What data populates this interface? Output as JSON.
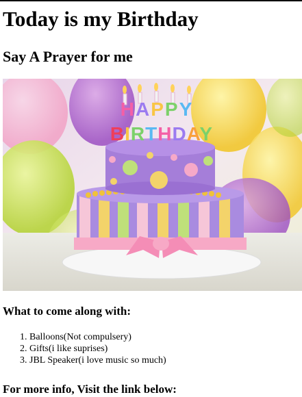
{
  "heading": "Today is my Birthday",
  "subheading": "Say A Prayer for me",
  "image": {
    "description_icon": "birthday-cake-image",
    "cake_text_top": "HAPPY",
    "cake_text_bottom": "BIRTHDAY"
  },
  "bring_heading": "What to come along with:",
  "bring_items": [
    "Balloons(Not compulsery)",
    "Gifts(i like suprises)",
    "JBL Speaker(i love music so much)"
  ],
  "more_info": "For more info, Visit the link below:"
}
